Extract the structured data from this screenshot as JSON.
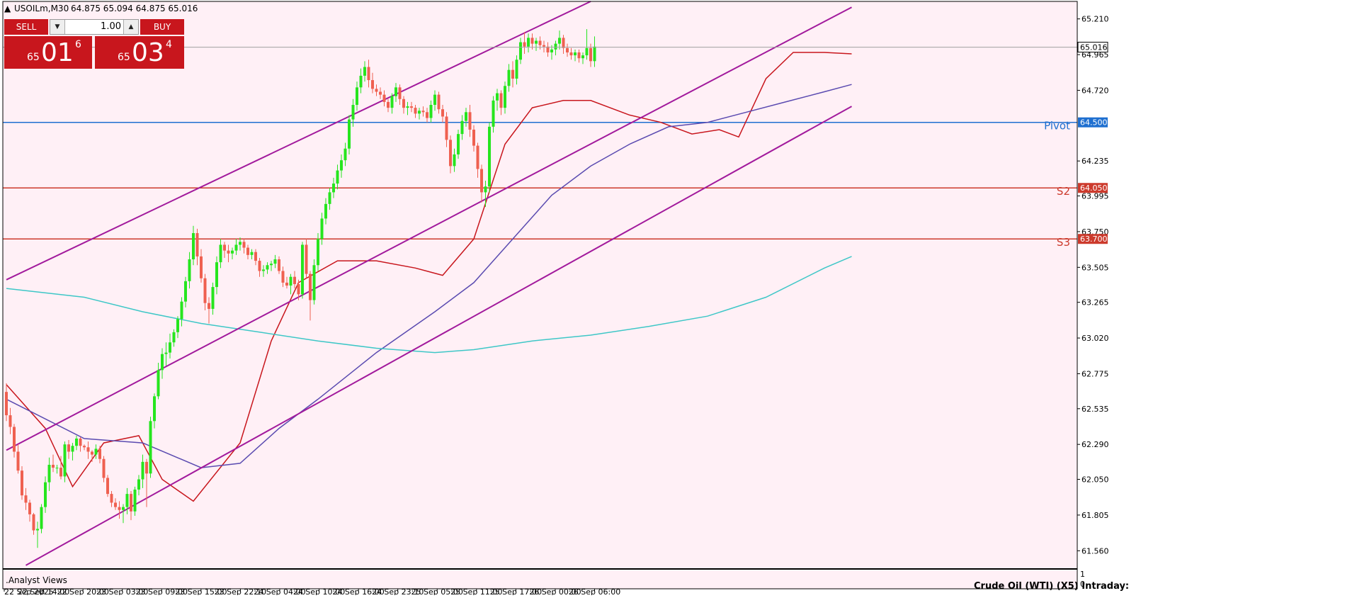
{
  "header": {
    "symbol": "USOILm,M30",
    "ohlc": "64.875 65.094 64.875 65.016"
  },
  "trade_panel": {
    "sell_label": "SELL",
    "buy_label": "BUY",
    "lot": "1.00",
    "sell_prefix": "65",
    "sell_big": "01",
    "sell_sup": "6",
    "buy_prefix": "65",
    "buy_big": "03",
    "buy_sup": "4"
  },
  "chart_data": {
    "type": "candlestick",
    "title": "",
    "ylim": [
      61.44,
      65.33
    ],
    "y_ticks": [
      "65.210",
      "64.965",
      "64.720",
      "64.235",
      "63.995",
      "63.750",
      "63.505",
      "63.265",
      "63.020",
      "62.775",
      "62.535",
      "62.290",
      "62.050",
      "61.805",
      "61.560"
    ],
    "x_ticks": [
      "22 Sep 2025",
      "22 Sep 14:00",
      "22 Sep 20:00",
      "23 Sep 03:00",
      "23 Sep 09:00",
      "23 Sep 15:00",
      "23 Sep 22:10",
      "24 Sep 04:00",
      "24 Sep 10:00",
      "24 Sep 16:00",
      "24 Sep 23:10",
      "25 Sep 05:00",
      "25 Sep 11:00",
      "25 Sep 17:00",
      "26 Sep 00:00",
      "26 Sep 06:00"
    ],
    "bull_color": "#26e51e",
    "bear_color": "#ef6050",
    "background": "#fff0f6",
    "grid": false,
    "current_price": {
      "value": 65.016,
      "label": "65.016"
    },
    "levels": [
      {
        "name": "Pivot",
        "value": 64.5,
        "label": "64.500",
        "color": "#1e6fd0"
      },
      {
        "name": "S2",
        "value": 64.05,
        "label": "64.050",
        "color": "#cc3a2c"
      },
      {
        "name": "S3",
        "value": 63.7,
        "label": "63.700",
        "color": "#cc3a2c"
      }
    ],
    "channel": {
      "color": "#a21a9c",
      "lines": [
        {
          "start": [
            0,
            63.42
          ],
          "end": [
            150,
            65.33
          ]
        },
        {
          "start": [
            0,
            62.25
          ],
          "end": [
            217,
            65.29
          ]
        },
        {
          "start": [
            5,
            61.46
          ],
          "end": [
            217,
            64.61
          ]
        }
      ]
    },
    "moving_averages": [
      {
        "color": "#c8161d",
        "points": [
          [
            0,
            62.7
          ],
          [
            10,
            62.4
          ],
          [
            17,
            62.0
          ],
          [
            25,
            62.3
          ],
          [
            34,
            62.35
          ],
          [
            40,
            62.05
          ],
          [
            48,
            61.9
          ],
          [
            60,
            62.3
          ],
          [
            68,
            63.0
          ],
          [
            75,
            63.4
          ],
          [
            85,
            63.55
          ],
          [
            95,
            63.55
          ],
          [
            105,
            63.5
          ],
          [
            112,
            63.45
          ],
          [
            120,
            63.7
          ],
          [
            128,
            64.35
          ],
          [
            135,
            64.6
          ],
          [
            143,
            64.65
          ],
          [
            150,
            64.65
          ],
          [
            160,
            64.55
          ],
          [
            168,
            64.5
          ],
          [
            176,
            64.42
          ],
          [
            183,
            64.45
          ],
          [
            188,
            64.4
          ],
          [
            195,
            64.8
          ],
          [
            202,
            64.98
          ],
          [
            210,
            64.98
          ],
          [
            217,
            64.97
          ]
        ]
      },
      {
        "color": "#5a4ab0",
        "points": [
          [
            0,
            62.6
          ],
          [
            20,
            62.33
          ],
          [
            35,
            62.3
          ],
          [
            50,
            62.13
          ],
          [
            60,
            62.16
          ],
          [
            70,
            62.4
          ],
          [
            80,
            62.6
          ],
          [
            95,
            62.92
          ],
          [
            110,
            63.2
          ],
          [
            120,
            63.4
          ],
          [
            130,
            63.7
          ],
          [
            140,
            64.0
          ],
          [
            150,
            64.2
          ],
          [
            160,
            64.35
          ],
          [
            170,
            64.47
          ],
          [
            180,
            64.5
          ],
          [
            190,
            64.57
          ],
          [
            200,
            64.64
          ],
          [
            210,
            64.71
          ],
          [
            217,
            64.76
          ]
        ]
      },
      {
        "color": "#3ec7c7",
        "points": [
          [
            0,
            63.36
          ],
          [
            20,
            63.3
          ],
          [
            35,
            63.2
          ],
          [
            50,
            63.12
          ],
          [
            65,
            63.06
          ],
          [
            80,
            63.0
          ],
          [
            95,
            62.95
          ],
          [
            110,
            62.92
          ],
          [
            120,
            62.94
          ],
          [
            135,
            63.0
          ],
          [
            150,
            63.04
          ],
          [
            165,
            63.1
          ],
          [
            180,
            63.17
          ],
          [
            195,
            63.3
          ],
          [
            210,
            63.5
          ],
          [
            217,
            63.58
          ]
        ]
      }
    ],
    "candles": [
      [
        62.65,
        62.71,
        62.45,
        62.49
      ],
      [
        62.49,
        62.54,
        62.36,
        62.41
      ],
      [
        62.41,
        62.43,
        62.2,
        62.24
      ],
      [
        62.24,
        62.29,
        62.09,
        62.11
      ],
      [
        62.11,
        62.14,
        61.91,
        61.94
      ],
      [
        61.94,
        61.99,
        61.84,
        61.89
      ],
      [
        61.89,
        61.91,
        61.76,
        61.81
      ],
      [
        61.81,
        61.82,
        61.67,
        61.7
      ],
      [
        61.7,
        61.76,
        61.58,
        61.71
      ],
      [
        61.71,
        61.88,
        61.68,
        61.86
      ],
      [
        61.86,
        62.07,
        61.82,
        62.03
      ],
      [
        62.03,
        62.2,
        61.97,
        62.15
      ],
      [
        62.15,
        62.22,
        62.1,
        62.13
      ],
      [
        62.13,
        62.15,
        62.09,
        62.13
      ],
      [
        62.13,
        62.21,
        62.05,
        62.07
      ],
      [
        62.07,
        62.31,
        62.03,
        62.29
      ],
      [
        62.29,
        62.32,
        62.19,
        62.24
      ],
      [
        62.24,
        62.3,
        62.18,
        62.28
      ],
      [
        62.28,
        62.35,
        62.25,
        62.33
      ],
      [
        62.33,
        62.34,
        62.24,
        62.28
      ],
      [
        62.28,
        62.29,
        62.25,
        62.27
      ],
      [
        62.27,
        62.31,
        62.19,
        62.24
      ],
      [
        62.24,
        62.25,
        62.17,
        62.22
      ],
      [
        62.22,
        62.29,
        62.19,
        62.26
      ],
      [
        62.26,
        62.28,
        62.16,
        62.19
      ],
      [
        62.19,
        62.21,
        62.03,
        62.06
      ],
      [
        62.06,
        62.08,
        61.93,
        61.95
      ],
      [
        61.95,
        61.97,
        61.86,
        61.89
      ],
      [
        61.89,
        61.92,
        61.84,
        61.86
      ],
      [
        61.86,
        61.9,
        61.78,
        61.84
      ],
      [
        61.84,
        61.88,
        61.75,
        61.86
      ],
      [
        61.86,
        61.99,
        61.81,
        61.95
      ],
      [
        61.95,
        61.97,
        61.77,
        61.83
      ],
      [
        61.83,
        62.0,
        61.8,
        61.98
      ],
      [
        61.98,
        62.08,
        61.94,
        62.05
      ],
      [
        62.05,
        62.22,
        61.99,
        62.17
      ],
      [
        62.17,
        62.19,
        61.86,
        62.09
      ],
      [
        62.09,
        62.48,
        62.06,
        62.45
      ],
      [
        62.45,
        62.64,
        62.4,
        62.62
      ],
      [
        62.62,
        62.85,
        62.6,
        62.8
      ],
      [
        62.8,
        62.95,
        62.74,
        62.91
      ],
      [
        62.91,
        62.99,
        62.83,
        62.92
      ],
      [
        62.92,
        63.05,
        62.88,
        62.99
      ],
      [
        62.99,
        63.08,
        62.96,
        63.06
      ],
      [
        63.06,
        63.17,
        63.02,
        63.15
      ],
      [
        63.15,
        63.3,
        63.1,
        63.27
      ],
      [
        63.27,
        63.44,
        63.23,
        63.41
      ],
      [
        63.41,
        63.61,
        63.36,
        63.56
      ],
      [
        63.56,
        63.79,
        63.52,
        63.74
      ],
      [
        63.74,
        63.77,
        63.52,
        63.58
      ],
      [
        63.58,
        63.63,
        63.4,
        63.43
      ],
      [
        63.43,
        63.46,
        63.21,
        63.26
      ],
      [
        63.26,
        63.3,
        63.12,
        63.22
      ],
      [
        63.22,
        63.4,
        63.18,
        63.37
      ],
      [
        63.37,
        63.58,
        63.32,
        63.54
      ],
      [
        63.54,
        63.7,
        63.5,
        63.66
      ],
      [
        63.66,
        63.68,
        63.57,
        63.62
      ],
      [
        63.62,
        63.66,
        63.54,
        63.6
      ],
      [
        63.6,
        63.64,
        63.56,
        63.62
      ],
      [
        63.62,
        63.7,
        63.59,
        63.66
      ],
      [
        63.66,
        63.71,
        63.62,
        63.68
      ],
      [
        63.68,
        63.7,
        63.6,
        63.64
      ],
      [
        63.64,
        63.66,
        63.56,
        63.59
      ],
      [
        63.59,
        63.63,
        63.56,
        63.61
      ],
      [
        63.61,
        63.63,
        63.52,
        63.55
      ],
      [
        63.55,
        63.57,
        63.44,
        63.48
      ],
      [
        63.48,
        63.52,
        63.44,
        63.49
      ],
      [
        63.49,
        63.54,
        63.46,
        63.52
      ],
      [
        63.52,
        63.55,
        63.48,
        63.53
      ],
      [
        63.53,
        63.59,
        63.5,
        63.56
      ],
      [
        63.56,
        63.58,
        63.46,
        63.48
      ],
      [
        63.48,
        63.51,
        63.37,
        63.4
      ],
      [
        63.4,
        63.44,
        63.36,
        63.38
      ],
      [
        63.38,
        63.46,
        63.32,
        63.44
      ],
      [
        63.44,
        63.48,
        63.36,
        63.39
      ],
      [
        63.39,
        63.42,
        63.28,
        63.32
      ],
      [
        63.32,
        63.68,
        63.29,
        63.66
      ],
      [
        63.66,
        63.7,
        63.43,
        63.46
      ],
      [
        63.46,
        63.48,
        63.14,
        63.28
      ],
      [
        63.28,
        63.56,
        63.25,
        63.52
      ],
      [
        63.52,
        63.74,
        63.48,
        63.7
      ],
      [
        63.7,
        63.88,
        63.66,
        63.84
      ],
      [
        63.84,
        63.98,
        63.8,
        63.94
      ],
      [
        63.94,
        64.05,
        63.9,
        64.02
      ],
      [
        64.02,
        64.12,
        63.98,
        64.08
      ],
      [
        64.08,
        64.21,
        64.04,
        64.17
      ],
      [
        64.17,
        64.28,
        64.12,
        64.24
      ],
      [
        64.24,
        64.36,
        64.2,
        64.32
      ],
      [
        64.32,
        64.55,
        64.28,
        64.52
      ],
      [
        64.52,
        64.66,
        64.47,
        64.62
      ],
      [
        64.62,
        64.78,
        64.58,
        64.74
      ],
      [
        64.74,
        64.87,
        64.7,
        64.82
      ],
      [
        64.82,
        64.92,
        64.78,
        64.88
      ],
      [
        64.88,
        64.93,
        64.74,
        64.79
      ],
      [
        64.79,
        64.84,
        64.7,
        64.73
      ],
      [
        64.73,
        64.76,
        64.68,
        64.71
      ],
      [
        64.71,
        64.74,
        64.66,
        64.69
      ],
      [
        64.69,
        64.72,
        64.61,
        64.64
      ],
      [
        64.64,
        64.66,
        64.57,
        64.6
      ],
      [
        64.6,
        64.7,
        64.56,
        64.68
      ],
      [
        64.68,
        64.77,
        64.64,
        64.74
      ],
      [
        64.74,
        64.76,
        64.62,
        64.66
      ],
      [
        64.66,
        64.68,
        64.56,
        64.6
      ],
      [
        64.6,
        64.64,
        64.55,
        64.61
      ],
      [
        64.61,
        64.64,
        64.57,
        64.6
      ],
      [
        64.6,
        64.62,
        64.53,
        64.56
      ],
      [
        64.56,
        64.6,
        64.52,
        64.58
      ],
      [
        64.58,
        64.61,
        64.54,
        64.57
      ],
      [
        64.57,
        64.6,
        64.5,
        64.53
      ],
      [
        64.53,
        64.65,
        64.5,
        64.62
      ],
      [
        64.62,
        64.72,
        64.58,
        64.69
      ],
      [
        64.69,
        64.71,
        64.56,
        64.59
      ],
      [
        64.59,
        64.62,
        64.5,
        64.54
      ],
      [
        64.54,
        64.57,
        64.33,
        64.38
      ],
      [
        64.38,
        64.41,
        64.15,
        64.2
      ],
      [
        64.2,
        64.32,
        64.16,
        64.28
      ],
      [
        64.28,
        64.45,
        64.25,
        64.42
      ],
      [
        64.42,
        64.55,
        64.38,
        64.51
      ],
      [
        64.51,
        64.6,
        64.47,
        64.57
      ],
      [
        64.57,
        64.62,
        64.4,
        64.45
      ],
      [
        64.45,
        64.48,
        64.3,
        64.34
      ],
      [
        64.34,
        64.36,
        64.12,
        64.18
      ],
      [
        64.18,
        64.21,
        63.95,
        64.02
      ],
      [
        64.02,
        64.1,
        63.92,
        64.06
      ],
      [
        64.06,
        64.5,
        64.02,
        64.47
      ],
      [
        64.47,
        64.68,
        64.43,
        64.65
      ],
      [
        64.65,
        64.73,
        64.58,
        64.7
      ],
      [
        64.7,
        64.72,
        64.55,
        64.6
      ],
      [
        64.6,
        64.78,
        64.56,
        64.75
      ],
      [
        64.75,
        64.9,
        64.71,
        64.86
      ],
      [
        64.86,
        64.92,
        64.74,
        64.8
      ],
      [
        64.8,
        64.96,
        64.76,
        64.93
      ],
      [
        64.93,
        65.08,
        64.9,
        65.05
      ],
      [
        65.05,
        65.12,
        64.97,
        65.02
      ],
      [
        65.02,
        65.11,
        64.98,
        65.08
      ],
      [
        65.08,
        65.11,
        65.0,
        65.04
      ],
      [
        65.04,
        65.08,
        64.99,
        65.06
      ],
      [
        65.06,
        65.09,
        65.0,
        65.03
      ],
      [
        65.03,
        65.06,
        64.98,
        65.02
      ],
      [
        65.02,
        65.05,
        64.95,
        64.98
      ],
      [
        64.98,
        65.03,
        64.93,
        65.0
      ],
      [
        65.0,
        65.06,
        64.96,
        65.04
      ],
      [
        65.04,
        65.13,
        65.0,
        65.08
      ],
      [
        65.08,
        65.1,
        64.97,
        65.01
      ],
      [
        65.01,
        65.04,
        64.95,
        64.98
      ],
      [
        64.98,
        65.01,
        64.93,
        64.96
      ],
      [
        64.96,
        65.0,
        64.92,
        64.98
      ],
      [
        64.98,
        65.0,
        64.91,
        64.94
      ],
      [
        64.94,
        64.98,
        64.9,
        64.96
      ],
      [
        64.96,
        65.14,
        64.93,
        65.01
      ],
      [
        65.01,
        65.04,
        64.88,
        64.92
      ],
      [
        64.92,
        65.09,
        64.88,
        65.02
      ]
    ]
  },
  "footer": {
    "indicator_label": ".Analyst Views",
    "indicator_text": "Crude Oil (WTI) (X5) Intraday:",
    "scale_top": "1",
    "scale_bottom": "0"
  }
}
